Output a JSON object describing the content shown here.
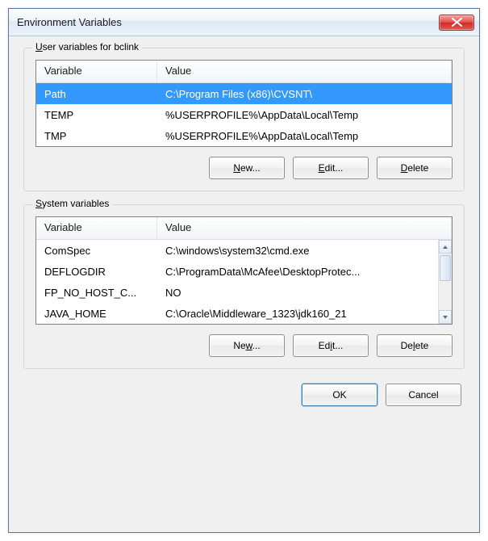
{
  "window": {
    "title": "Environment Variables"
  },
  "user_group": {
    "label_pre": "U",
    "label_rest": "ser variables for bclink",
    "columns": {
      "variable": "Variable",
      "value": "Value"
    },
    "rows": [
      {
        "variable": "Path",
        "value": "C:\\Program Files (x86)\\CVSNT\\",
        "selected": true
      },
      {
        "variable": "TEMP",
        "value": "%USERPROFILE%\\AppData\\Local\\Temp",
        "selected": false
      },
      {
        "variable": "TMP",
        "value": "%USERPROFILE%\\AppData\\Local\\Temp",
        "selected": false
      }
    ],
    "buttons": {
      "new_pre": "N",
      "new_rest": "ew...",
      "edit_pre": "E",
      "edit_rest": "dit...",
      "del_pre": "D",
      "del_rest": "elete"
    }
  },
  "sys_group": {
    "label_pre": "S",
    "label_rest": "ystem variables",
    "columns": {
      "variable": "Variable",
      "value": "Value"
    },
    "rows": [
      {
        "variable": "ComSpec",
        "value": "C:\\windows\\system32\\cmd.exe"
      },
      {
        "variable": "DEFLOGDIR",
        "value": "C:\\ProgramData\\McAfee\\DesktopProtec..."
      },
      {
        "variable": "FP_NO_HOST_C...",
        "value": "NO"
      },
      {
        "variable": "JAVA_HOME",
        "value": "C:\\Oracle\\Middleware_1323\\jdk160_21"
      }
    ],
    "buttons": {
      "new_pre": "Ne",
      "new_accel": "w",
      "new_rest": "...",
      "edit_pre": "Ed",
      "edit_accel": "i",
      "edit_rest": "t...",
      "del_pre": "De",
      "del_accel": "l",
      "del_rest": "ete"
    }
  },
  "dialog_buttons": {
    "ok": "OK",
    "cancel": "Cancel"
  }
}
